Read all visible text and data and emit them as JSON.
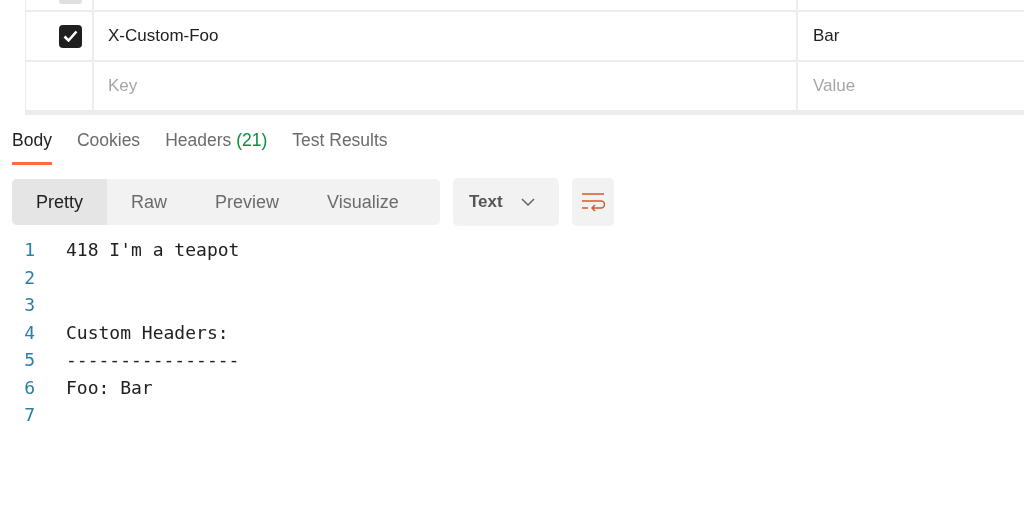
{
  "headers_table": {
    "rows": [
      {
        "kind": "cut",
        "checked": false
      },
      {
        "kind": "entry",
        "checked": true,
        "key": "X-Custom-Foo",
        "value": "Bar"
      },
      {
        "kind": "new",
        "key_placeholder": "Key",
        "value_placeholder": "Value"
      }
    ]
  },
  "response_tabs": [
    {
      "label": "Body",
      "selected": true
    },
    {
      "label": "Cookies",
      "selected": false
    },
    {
      "label": "Headers",
      "count": "(21)",
      "selected": false
    },
    {
      "label": "Test Results",
      "selected": false
    }
  ],
  "view_modes": [
    {
      "label": "Pretty",
      "selected": true
    },
    {
      "label": "Raw",
      "selected": false
    },
    {
      "label": "Preview",
      "selected": false
    },
    {
      "label": "Visualize",
      "selected": false
    }
  ],
  "format_dropdown": {
    "value": "Text"
  },
  "code_lines": [
    {
      "number": "1",
      "text": "418 I'm a teapot"
    },
    {
      "number": "2"
    },
    {
      "number": "3"
    },
    {
      "number": "4",
      "text": "Custom Headers:"
    },
    {
      "number": "5",
      "text": "----------------"
    },
    {
      "number": "6",
      "text": "Foo: Bar"
    },
    {
      "number": "7"
    }
  ]
}
